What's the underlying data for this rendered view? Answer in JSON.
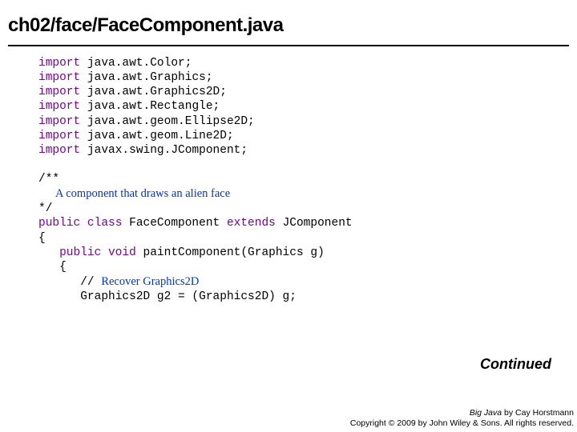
{
  "title": "ch02/face/FaceComponent.java",
  "code": {
    "imports": [
      {
        "kw": "import",
        "rest": " java.awt.Color;"
      },
      {
        "kw": "import",
        "rest": " java.awt.Graphics;"
      },
      {
        "kw": "import",
        "rest": " java.awt.Graphics2D;"
      },
      {
        "kw": "import",
        "rest": " java.awt.Rectangle;"
      },
      {
        "kw": "import",
        "rest": " java.awt.geom.Ellipse2D;"
      },
      {
        "kw": "import",
        "rest": " java.awt.geom.Line2D;"
      },
      {
        "kw": "import",
        "rest": " javax.swing.JComponent;"
      }
    ],
    "javadoc_open": "/**",
    "javadoc_body": "      A component that draws an alien face",
    "javadoc_close": "*/",
    "class_kw1": "public class",
    "class_name": " FaceComponent ",
    "class_kw2": "extends",
    "class_super": " JComponent",
    "brace_open": "{",
    "method_indent": "   ",
    "method_kw": "public void",
    "method_sig": " paintComponent(Graphics g)",
    "method_brace_open": "   {",
    "comment_indent": "      // ",
    "comment_text": "Recover Graphics2D",
    "body_line": "      Graphics2D g2 = (Graphics2D) g;"
  },
  "continued": "Continued",
  "footer": {
    "line1_book": "Big Java",
    "line1_rest": " by Cay Horstmann",
    "line2": "Copyright © 2009 by John Wiley & Sons.  All rights reserved."
  }
}
